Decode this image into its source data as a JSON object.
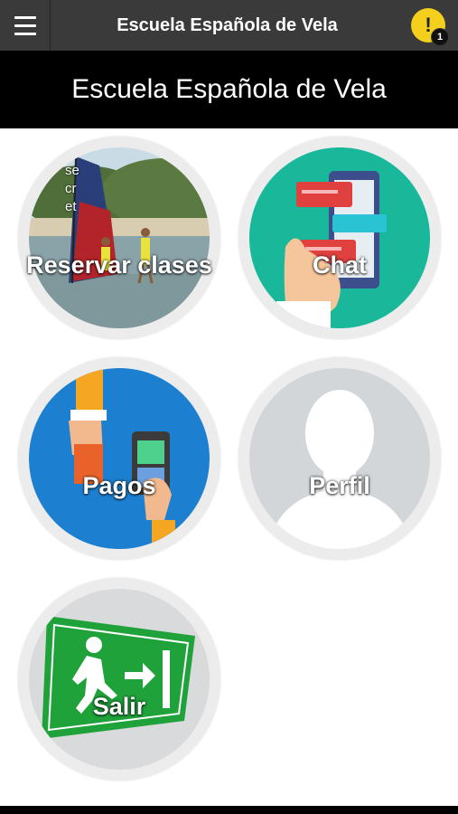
{
  "header": {
    "title": "Escuela Española de Vela",
    "menu_icon": "hamburger-menu-icon",
    "alert_icon": "exclamation-icon",
    "alert_symbol": "!",
    "alert_count": "1",
    "accent_color": "#f4d01c"
  },
  "banner": {
    "title": "Escuela Española de Vela"
  },
  "tiles": [
    {
      "label": "Reservar clases",
      "icon": "windsurf-photo"
    },
    {
      "label": "Chat",
      "icon": "chat-phone-icon"
    },
    {
      "label": "Pagos",
      "icon": "payment-terminal-icon"
    },
    {
      "label": "Perfil",
      "icon": "user-silhouette-icon"
    },
    {
      "label": "Salir",
      "icon": "exit-sign-icon"
    }
  ],
  "photo_overlay_text": [
    "se",
    "cr",
    "et"
  ]
}
